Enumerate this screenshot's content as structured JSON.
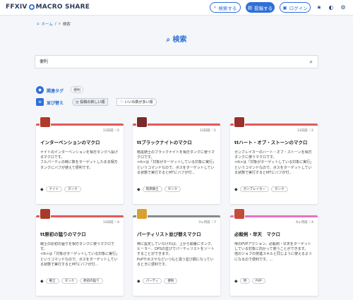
{
  "header": {
    "logo_text": "FFXIV",
    "logo_text2": "MACRO SHARE",
    "search_label": "検索する",
    "post_label": "投稿する",
    "login_label": "ログイン"
  },
  "breadcrumb": {
    "home": "ホーム",
    "current": "検索"
  },
  "page_title": "検索",
  "search": {
    "value": "便利"
  },
  "filters": {
    "tags_label": "関連タグ",
    "tag_chip": "便利",
    "sort_label": "並び替え",
    "sort_options": [
      "投稿の新しい順",
      "いいね数が多い順"
    ]
  },
  "cards": [
    {
      "accent": "#e05a5a",
      "date": "13日前",
      "likes": "2",
      "title": "インターベンションのマクロ",
      "desc": "ナイトのインターベンションを相方タンクへ投げるマクロです。\nフルパーティの時に数をターゲットしたまま相方タンクにバフが使えて便利です。",
      "tags": [
        "ナイト",
        "タンク"
      ]
    },
    {
      "accent": "#e05a5a",
      "date": "13日前",
      "likes": "1",
      "title": "ttブラックナイトのマクロ",
      "desc": "暗黒騎士のブラックナイトを相方タンクに使うマクロです。\n<tt>は「対象がターゲットしている対象に実行」というコマンドなので、ボスをターゲットしている状態で実行するとMTにバフが付...",
      "tags": [
        "暗黒騎士",
        "タンク"
      ]
    },
    {
      "accent": "#e05a5a",
      "date": "13日前",
      "likes": "2",
      "title": "ttハート・オブ・ストーンのマクロ",
      "desc": "ガンブレイカーのハート・オブ・ストーンを相方タンクに使うマクロです。\n<tt>は「対象がターゲットしている対象に実行」というコマンドなので、ボスをターゲットしている状態で実行するとMTにバフが付...",
      "tags": [
        "ガンブレイカー",
        "タンク"
      ]
    },
    {
      "accent": "#e05a5a",
      "date": "13日前",
      "likes": "4",
      "title": "tt原初の猛りのマクロ",
      "desc": "戦士の原初の猛りを相方タンクに使うマクロです。\n<tt>は「対象がターゲットしている対象に実行」というコマンドなので、ボスをターゲットしている状態で実行するとMTにバフが付...",
      "tags": [
        "戦士",
        "タンク",
        "原初の猛り"
      ]
    },
    {
      "accent": "#8a8a8a",
      "date": "3ヶ月前",
      "likes": "7",
      "title": "パーティリスト並び替えマクロ",
      "desc": "特に設定していなければ、上から順番にタンク、ヒーラー、DPSの並びでパーティリストをソートすることができます。\nPvPやボスヤなどいつもと違う並び順になっているときに便利です。",
      "tags": [
        "パーティ",
        "便利"
      ]
    },
    {
      "accent": "#e872c0",
      "date": "6ヶ月前",
      "likes": "4",
      "title": "必殺剣・早天　マクロ",
      "desc": "侍のPVPアクション、必殺剣・早天をターゲットしている対象に向かって使うことができます。\n他のジョブの突進スキルと同じように使えるようになるので便利です。...",
      "tags": [
        "侍",
        "PVP"
      ]
    }
  ]
}
